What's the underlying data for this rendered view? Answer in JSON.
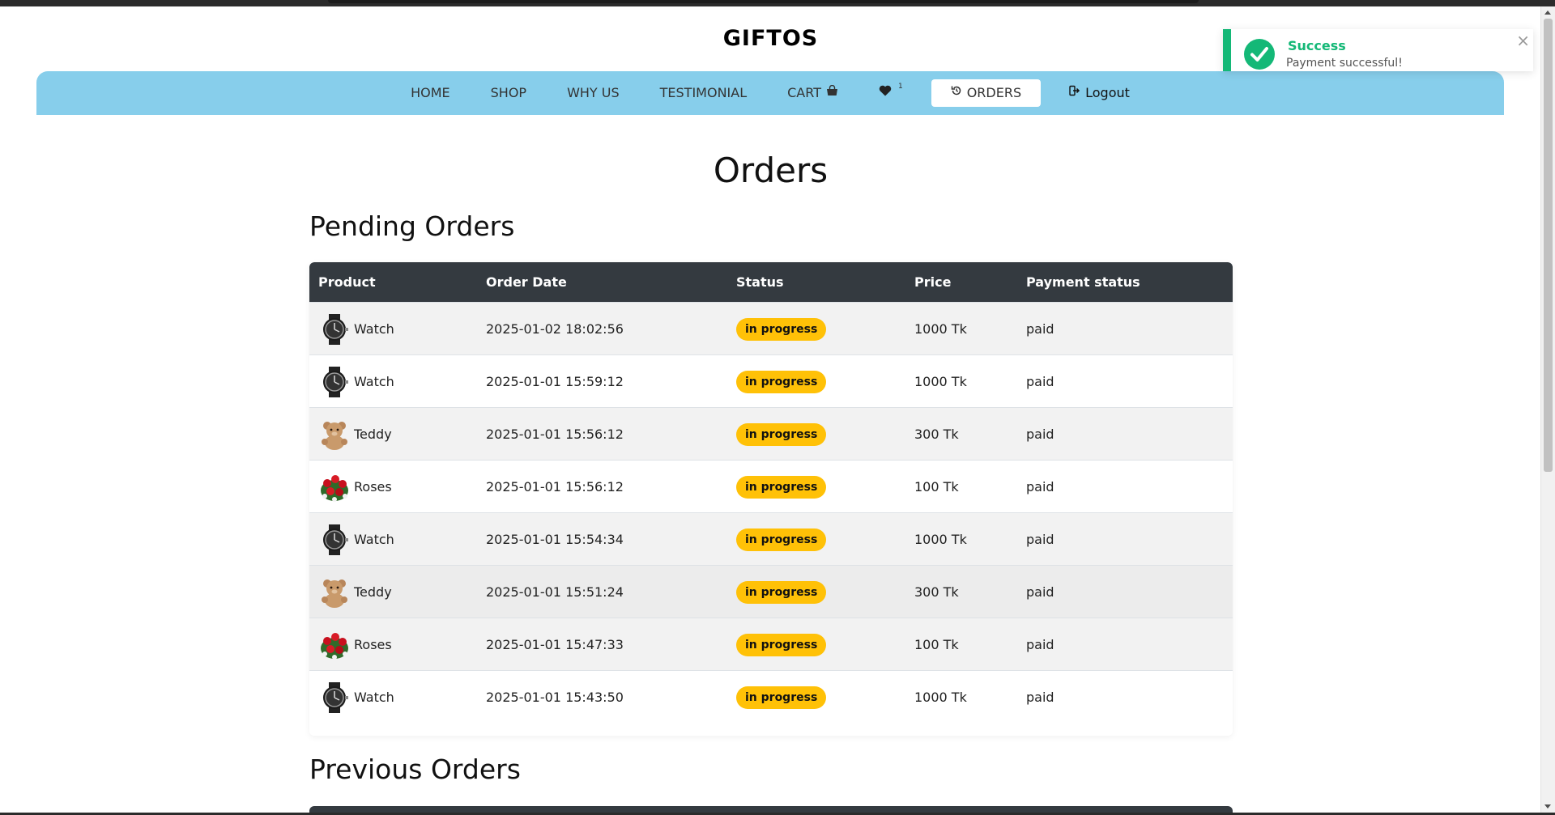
{
  "brand": "GIFTOS",
  "nav": {
    "home": "HOME",
    "shop": "SHOP",
    "why_us": "WHY US",
    "testimonial": "TESTIMONIAL",
    "cart": "CART",
    "wishlist_count": "1",
    "orders": "ORDERS",
    "logout": "Logout"
  },
  "toast": {
    "title": "Success",
    "message": "Payment successful!",
    "close": "×"
  },
  "page_title": "Orders",
  "pending": {
    "title": "Pending Orders",
    "columns": [
      "Product",
      "Order Date",
      "Status",
      "Price",
      "Payment status"
    ],
    "rows": [
      {
        "product": "Watch",
        "icon": "watch-icon",
        "date": "2025-01-02 18:02:56",
        "status": "in progress",
        "price": "1000 Tk",
        "payment": "paid"
      },
      {
        "product": "Watch",
        "icon": "watch-icon",
        "date": "2025-01-01 15:59:12",
        "status": "in progress",
        "price": "1000 Tk",
        "payment": "paid"
      },
      {
        "product": "Teddy",
        "icon": "teddy-icon",
        "date": "2025-01-01 15:56:12",
        "status": "in progress",
        "price": "300 Tk",
        "payment": "paid"
      },
      {
        "product": "Roses",
        "icon": "roses-icon",
        "date": "2025-01-01 15:56:12",
        "status": "in progress",
        "price": "100 Tk",
        "payment": "paid"
      },
      {
        "product": "Watch",
        "icon": "watch-icon",
        "date": "2025-01-01 15:54:34",
        "status": "in progress",
        "price": "1000 Tk",
        "payment": "paid"
      },
      {
        "product": "Teddy",
        "icon": "teddy-icon",
        "date": "2025-01-01 15:51:24",
        "status": "in progress",
        "price": "300 Tk",
        "payment": "paid"
      },
      {
        "product": "Roses",
        "icon": "roses-icon",
        "date": "2025-01-01 15:47:33",
        "status": "in progress",
        "price": "100 Tk",
        "payment": "paid"
      },
      {
        "product": "Watch",
        "icon": "watch-icon",
        "date": "2025-01-01 15:43:50",
        "status": "in progress",
        "price": "1000 Tk",
        "payment": "paid"
      }
    ]
  },
  "previous": {
    "title": "Previous Orders"
  },
  "colors": {
    "nav_bg": "#87ceeb",
    "table_header": "#343a40",
    "badge_warning": "#ffc107",
    "success": "#14b877"
  }
}
